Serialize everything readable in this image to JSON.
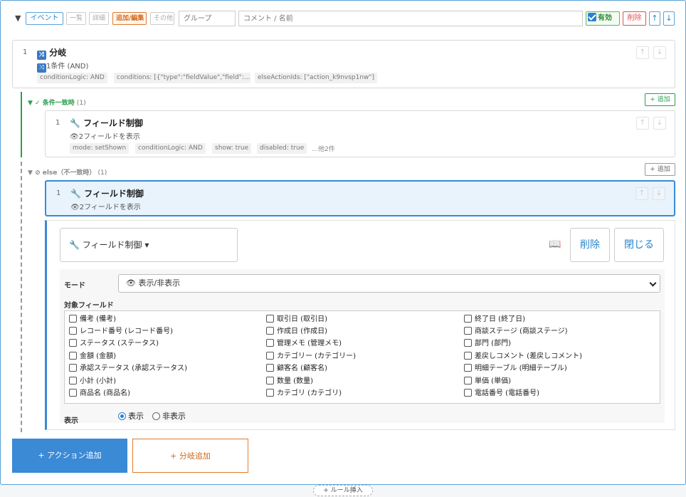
{
  "header": {
    "tags": [
      "イベント",
      "一覧",
      "詳細",
      "追加/編集",
      "その他"
    ],
    "group_placeholder": "グループ",
    "comment_placeholder": "コメント / 名前",
    "enabled_label": "有効",
    "delete_label": "削除",
    "up_arrow": "↑",
    "down_arrow": "↓"
  },
  "branch_card": {
    "number": "1",
    "title": "分岐",
    "subtitle": "1条件 (AND)",
    "pills": [
      "conditionLogic: AND",
      "conditions: [{\"type\":\"fieldValue\",\"field\":...",
      "elseActionIds: [\"action_k9nvsp1nw\"]"
    ]
  },
  "match_section": {
    "label": "✓ 条件一致時",
    "count": "(1)",
    "add_label": "+ 追加",
    "card": {
      "number": "1",
      "title": "フィールド制御",
      "subtitle": "2フィールドを表示",
      "pills": [
        "mode: setShown",
        "conditionLogic: AND",
        "show: true",
        "disabled: true"
      ],
      "more": "…他2件"
    }
  },
  "else_section": {
    "label": "⊘ else（不一致時）",
    "count": "(1)",
    "add_label": "+ 追加",
    "card": {
      "number": "1",
      "title": "フィールド制御",
      "subtitle": "2フィールドを表示"
    }
  },
  "editor": {
    "type_label": "フィールド制御",
    "delete_label": "削除",
    "close_label": "閉じる",
    "mode_label": "モード",
    "mode_value": "表示/非表示",
    "fields_label": "対象フィールド",
    "fields": [
      [
        "備考 (備考)",
        "レコード番号 (レコード番号)",
        "ステータス (ステータス)",
        "金額 (金額)",
        "承認ステータス (承認ステータス)",
        "小計 (小計)",
        "商品名 (商品名)"
      ],
      [
        "取引日 (取引日)",
        "作成日 (作成日)",
        "管理メモ (管理メモ)",
        "カテゴリー (カテゴリー)",
        "顧客名 (顧客名)",
        "数量 (数量)",
        "カテゴリ (カテゴリ)"
      ],
      [
        "終了日 (終了日)",
        "商談ステージ (商談ステージ)",
        "部門 (部門)",
        "差戻しコメント (差戻しコメント)",
        "明細テーブル (明細テーブル)",
        "単価 (単価)",
        "電話番号 (電話番号)"
      ]
    ],
    "display_label": "表示",
    "radio_show": "表示",
    "radio_hide": "非表示"
  },
  "actions": {
    "add_action": "+ アクション追加",
    "add_branch": "+ 分岐追加"
  },
  "rule_insert": "+ ルール挿入",
  "colors": {
    "accent": "#3a8ad6",
    "match_green": "#2e9e4f",
    "orange": "#e07a2c",
    "danger": "#d9534f"
  }
}
